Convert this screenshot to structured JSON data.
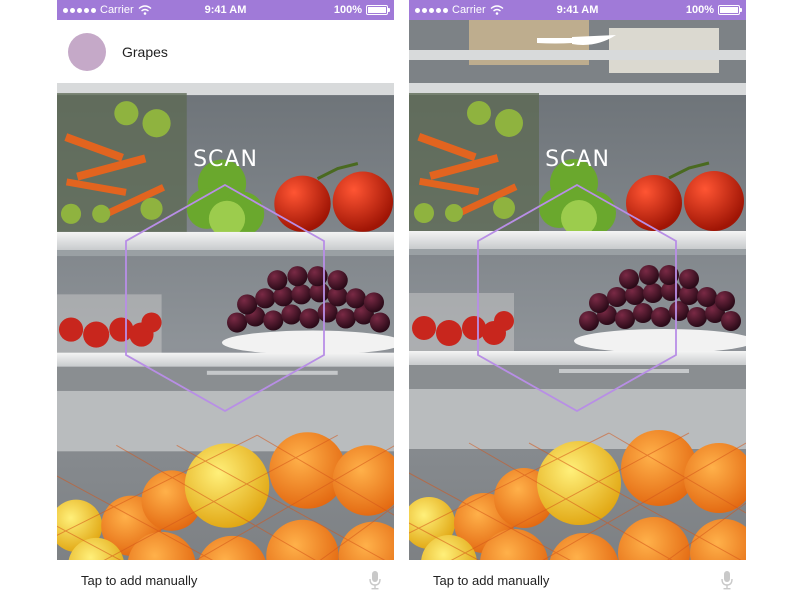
{
  "status_bar": {
    "carrier": "Carrier",
    "time": "9:41 AM",
    "battery": "100%"
  },
  "screens": [
    {
      "detected_item": "Grapes",
      "scan_label": "SCAN",
      "footer_prompt": "Tap to add manually"
    },
    {
      "scan_label": "SCAN",
      "footer_prompt": "Tap to add manually"
    }
  ],
  "colors": {
    "accent": "#a07ad8",
    "avatar": "#c5a9c8"
  },
  "icons": [
    "wifi-icon",
    "battery-icon",
    "mic-icon",
    "knife-icon"
  ]
}
